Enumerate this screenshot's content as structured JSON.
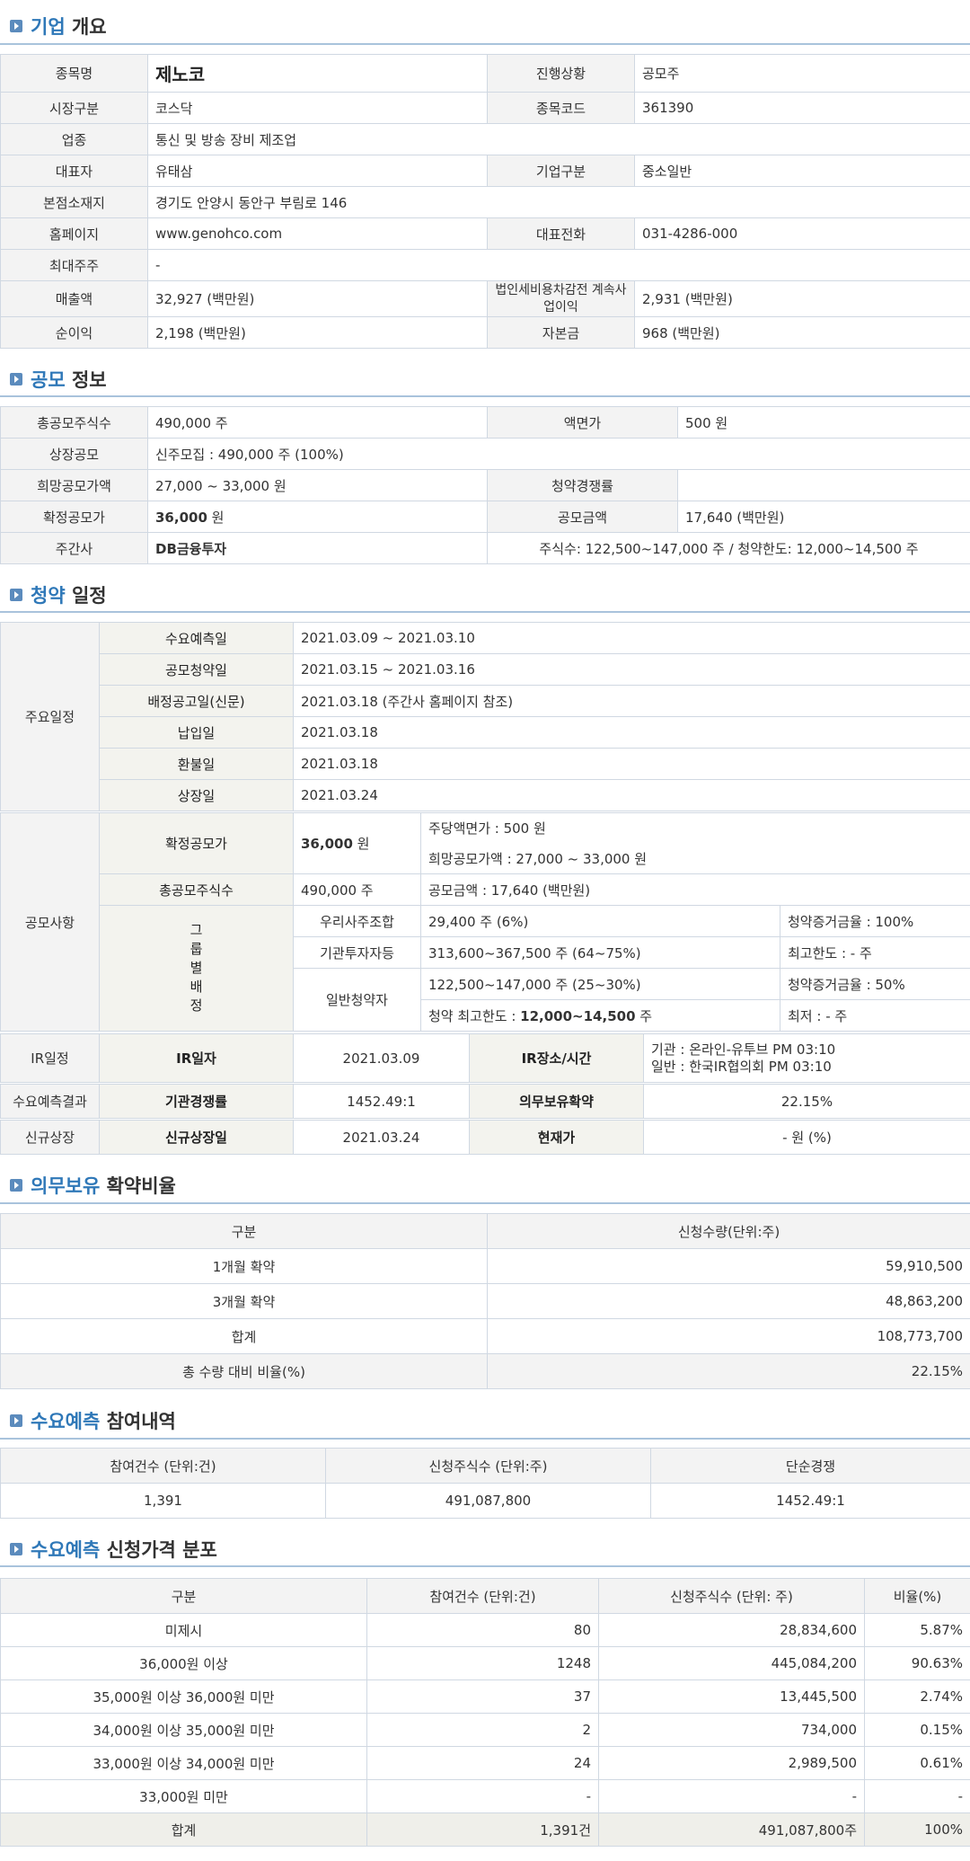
{
  "overview": {
    "heading_accent": "기업",
    "heading_rest": "개요",
    "rows": {
      "name_label": "종목명",
      "name_value": "제노코",
      "status_label": "진행상황",
      "status_value": "공모주",
      "market_label": "시장구분",
      "market_value": "코스닥",
      "code_label": "종목코드",
      "code_value": "361390",
      "industry_label": "업종",
      "industry_value": "통신 및 방송 장비 제조업",
      "ceo_label": "대표자",
      "ceo_value": "유태삼",
      "corp_type_label": "기업구분",
      "corp_type_value": "중소일반",
      "address_label": "본점소재지",
      "address_value": "경기도 안양시 동안구 부림로 146",
      "homepage_label": "홈페이지",
      "homepage_value": "www.genohco.com",
      "phone_label": "대표전화",
      "phone_value": "031-4286-000",
      "shareholder_label": "최대주주",
      "shareholder_value": "-",
      "sales_label": "매출액",
      "sales_value": "32,927 (백만원)",
      "pretax_label": "법인세비용차감전 계속사업이익",
      "pretax_value": "2,931 (백만원)",
      "netincome_label": "순이익",
      "netincome_value": "2,198 (백만원)",
      "capital_label": "자본금",
      "capital_value": "968 (백만원)"
    }
  },
  "offering": {
    "heading_accent": "공모",
    "heading_rest": "정보",
    "total_shares_label": "총공모주식수",
    "total_shares_value": "490,000 주",
    "face_value_label": "액면가",
    "face_value_value": "500 원",
    "listing_label": "상장공모",
    "listing_value": "신주모집 : 490,000 주 (100%)",
    "hope_price_label": "희망공모가액",
    "hope_price_value": "27,000 ~ 33,000 원",
    "competition_label": "청약경쟁률",
    "competition_value": "",
    "final_price_label": "확정공모가",
    "final_price_value": "36,000",
    "final_price_unit": " 원",
    "amount_label": "공모금액",
    "amount_value": "17,640 (백만원)",
    "underwriter_label": "주간사",
    "underwriter_value": "DB금융투자",
    "underwriter_detail": "주식수: 122,500~147,000 주   /   청약한도: 12,000~14,500 주"
  },
  "subscription": {
    "heading_accent": "청약",
    "heading_rest": "일정",
    "main_schedule_label": "주요일정",
    "demand_forecast_label": "수요예측일",
    "demand_forecast_value": "2021.03.09  ~   2021.03.10",
    "subscription_date_label": "공모청약일",
    "subscription_date_value": "2021.03.15  ~   2021.03.16",
    "allotment_label": "배정공고일(신문)",
    "allotment_value": "2021.03.18 (주간사 홈페이지 참조)",
    "payment_label": "납입일",
    "payment_value": "2021.03.18",
    "refund_label": "환불일",
    "refund_value": "2021.03.18",
    "listing_date_label": "상장일",
    "listing_date_value": "2021.03.24",
    "offering_items_label": "공모사항",
    "final_price_label": "확정공모가",
    "final_price_value": "36,000",
    "final_price_unit": " 원",
    "par_value_text": "주당액면가 :  500 원",
    "hope_price_text": "희망공모가액 :  27,000 ~ 33,000 원",
    "total_shares_label": "총공모주식수",
    "total_shares_value": "490,000 주",
    "amount_text": "공모금액 : 17,640 (백만원)",
    "group_label": "그 룹 별 배 정",
    "employee_label": "우리사주조합",
    "employee_value": "29,400 주  (6%)",
    "employee_note": "청약증거금율 : 100%",
    "institution_label": "기관투자자등",
    "institution_value": "313,600~367,500 주  (64~75%)",
    "institution_note": "최고한도 :  - 주",
    "general_label": "일반청약자",
    "general_value": "122,500~147,000 주  (25~30%)",
    "general_note": "청약증거금율 : 50%",
    "general_limit_prefix": "청약 최고한도 :  ",
    "general_limit_value": "12,000~14,500",
    "general_limit_unit": " 주",
    "general_min_note": "최저 :  - 주",
    "ir_schedule_label": "IR일정",
    "ir_date_label": "IR일자",
    "ir_date_value": "2021.03.09",
    "ir_place_label": "IR장소/시간",
    "ir_place_line1": "기관 : 온라인-유투브 PM 03:10",
    "ir_place_line2": "일반 : 한국IR협의회 PM 03:10",
    "demand_result_label": "수요예측결과",
    "inst_competition_label": "기관경쟁률",
    "inst_competition_value": "1452.49:1",
    "lockup_label": "의무보유확약",
    "lockup_value": "22.15%",
    "new_listing_label": "신규상장",
    "new_listing_date_label": "신규상장일",
    "new_listing_date_value": "2021.03.24",
    "current_price_label": "현재가",
    "current_price_value": "- 원 (%)"
  },
  "lockup": {
    "heading_accent": "의무보유",
    "heading_rest": "확약비율",
    "header_type": "구분",
    "header_qty": "신청수량(단위:주)",
    "rows": [
      {
        "label": "1개월 확약",
        "value": "59,910,500"
      },
      {
        "label": "3개월 확약",
        "value": "48,863,200"
      },
      {
        "label": "합계",
        "value": "108,773,700"
      },
      {
        "label": "총 수량 대비 비율(%)",
        "value": "22.15%"
      }
    ]
  },
  "participation": {
    "heading_accent": "수요예측",
    "heading_rest": "참여내역",
    "header_count": "참여건수 (단위:건)",
    "header_shares": "신청주식수 (단위:주)",
    "header_competition": "단순경쟁",
    "count": "1,391",
    "shares": "491,087,800",
    "competition": "1452.49:1"
  },
  "distribution": {
    "heading_accent": "수요예측",
    "heading_rest": "신청가격 분포",
    "header_type": "구분",
    "header_count": "참여건수 (단위:건)",
    "header_shares": "신청주식수 (단위: 주)",
    "header_ratio": "비율(%)",
    "rows": [
      {
        "label": "미제시",
        "count": "80",
        "shares": "28,834,600",
        "ratio": "5.87%"
      },
      {
        "label": "36,000원 이상",
        "count": "1248",
        "shares": "445,084,200",
        "ratio": "90.63%"
      },
      {
        "label": "35,000원 이상 36,000원 미만",
        "count": "37",
        "shares": "13,445,500",
        "ratio": "2.74%"
      },
      {
        "label": "34,000원 이상 35,000원 미만",
        "count": "2",
        "shares": "734,000",
        "ratio": "0.15%"
      },
      {
        "label": "33,000원 이상 34,000원 미만",
        "count": "24",
        "shares": "2,989,500",
        "ratio": "0.61%"
      },
      {
        "label": "33,000원 미만",
        "count": "-",
        "shares": "-",
        "ratio": "-"
      }
    ],
    "total": {
      "label": "합계",
      "count": "1,391건",
      "shares": "491,087,800주",
      "ratio": "100%"
    }
  }
}
